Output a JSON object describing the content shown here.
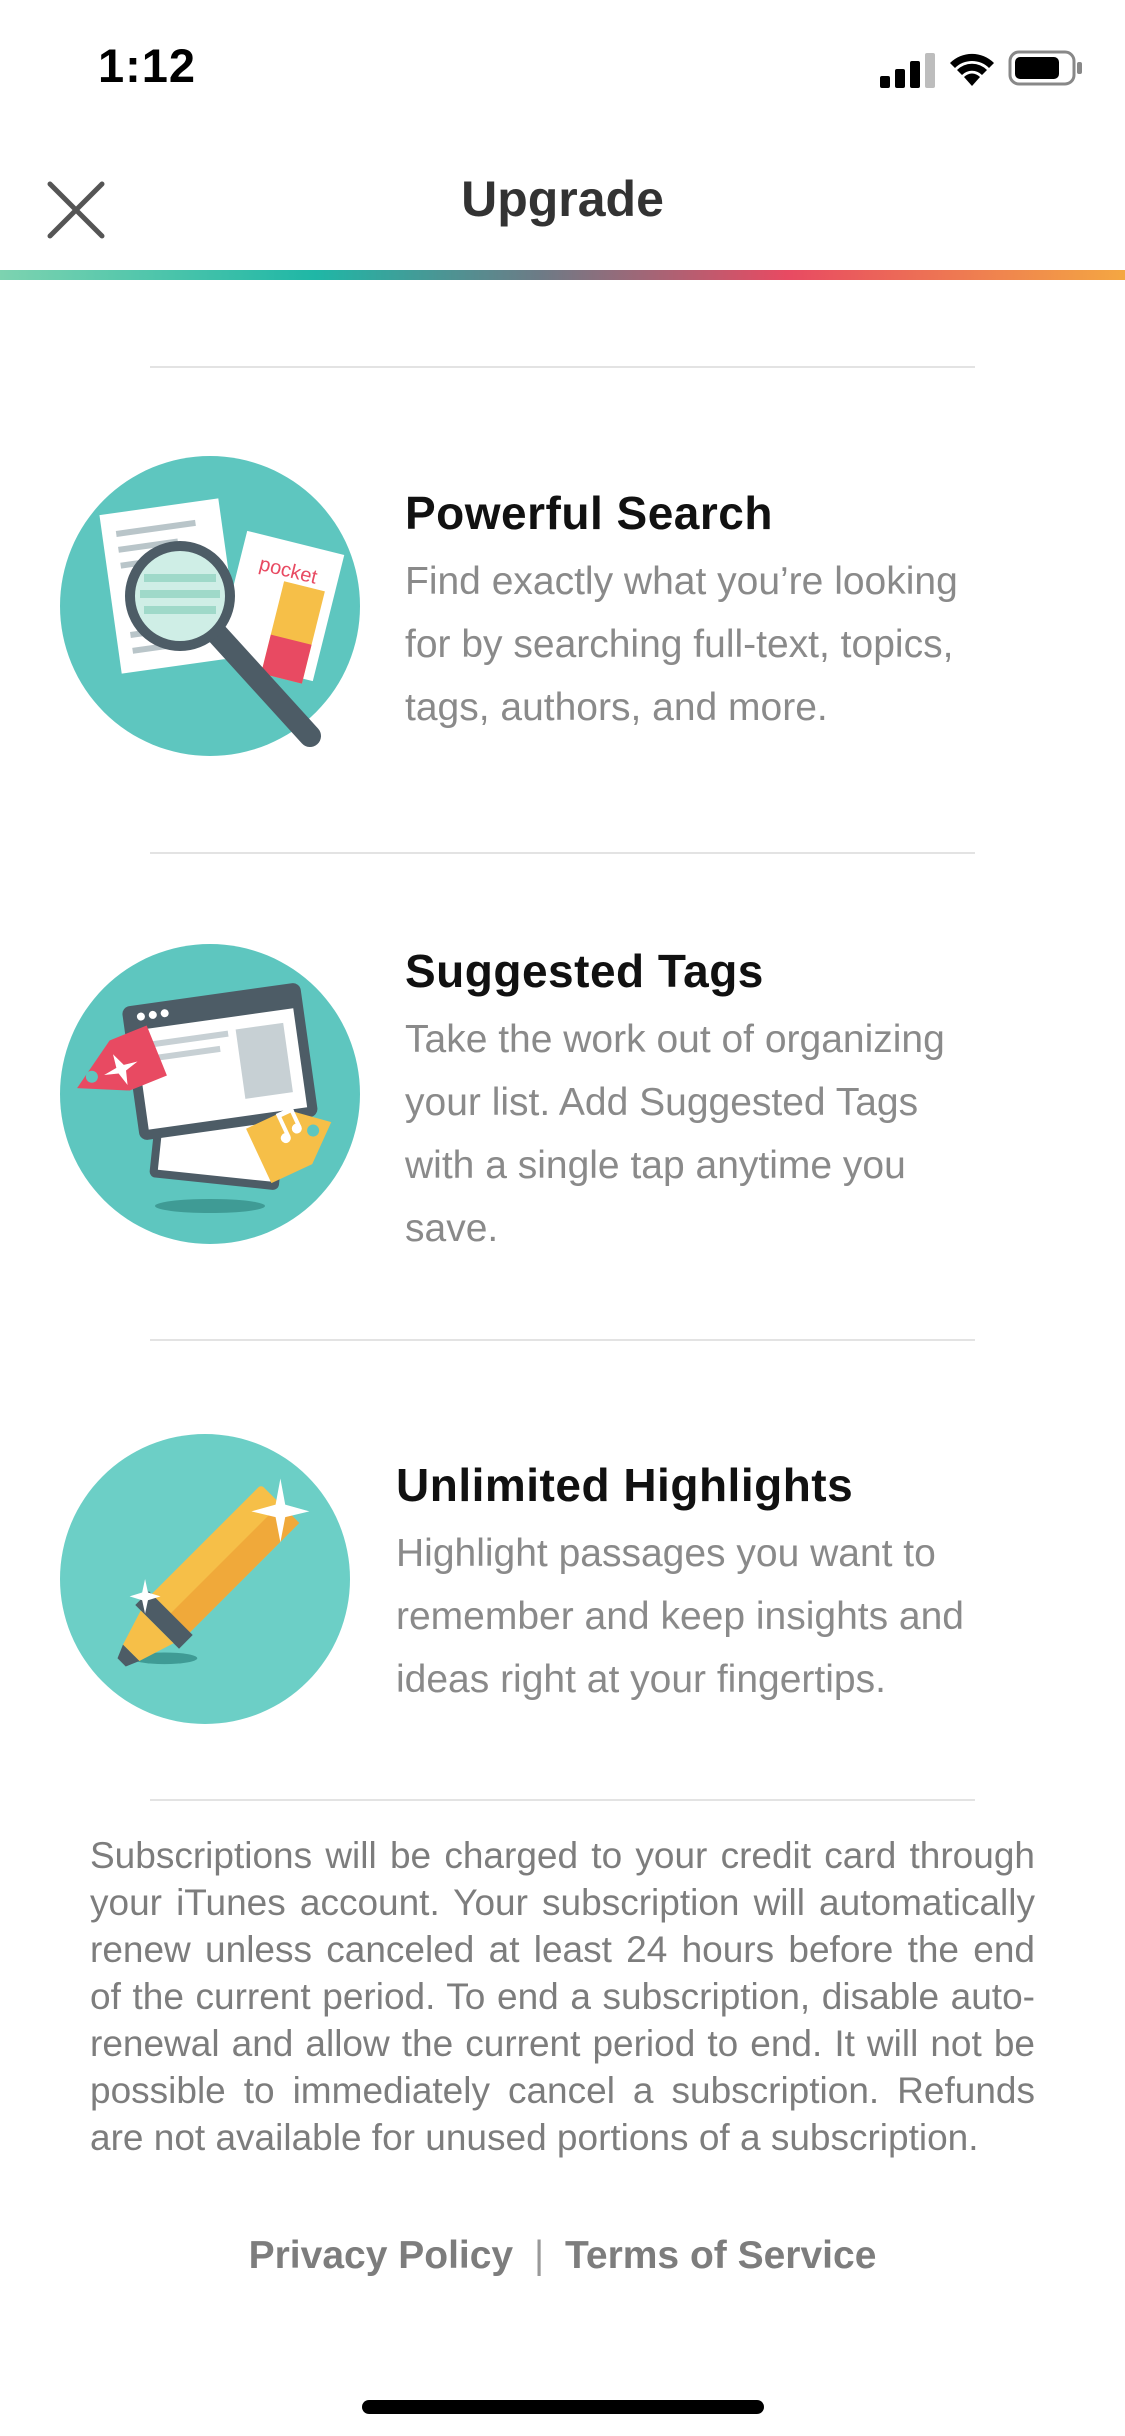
{
  "status_bar": {
    "time": "1:12"
  },
  "header": {
    "title": "Upgrade",
    "close_icon": "close-icon"
  },
  "colors": {
    "teal": "#5ec6bf",
    "accent_gradient": [
      "#7dd3b0",
      "#1fb7a6",
      "#6d7b86",
      "#e84a62",
      "#f4a742"
    ]
  },
  "features": [
    {
      "icon": "magnifier-icon",
      "title": "Powerful Search",
      "lines": [
        "Find exactly what you’re looking",
        "for by searching full-text, topics,",
        "tags, authors, and more."
      ]
    },
    {
      "icon": "tags-icon",
      "title": "Suggested Tags",
      "lines": [
        "Take the work out of organizing",
        "your list. Add Suggested Tags",
        "with a single tap anytime you",
        "save."
      ]
    },
    {
      "icon": "highlighter-icon",
      "title": "Unlimited Highlights",
      "lines": [
        "Highlight passages you want to",
        "remember and keep insights and",
        "ideas right at your fingertips."
      ]
    }
  ],
  "illustration_text": {
    "pocket_label": "pocket"
  },
  "legal_text": "Subscriptions will be charged to your credit card through your iTunes account. Your subscription will automatically renew unless canceled at least 24 hours before the end of the current period. To end a subscription, disable auto-renewal and allow the current period to end. It will not be possible to immediately cancel a subscription. Refunds are not available for unused portions of a subscription.",
  "links": {
    "privacy": "Privacy Policy",
    "separator": "|",
    "terms": "Terms of Service"
  }
}
